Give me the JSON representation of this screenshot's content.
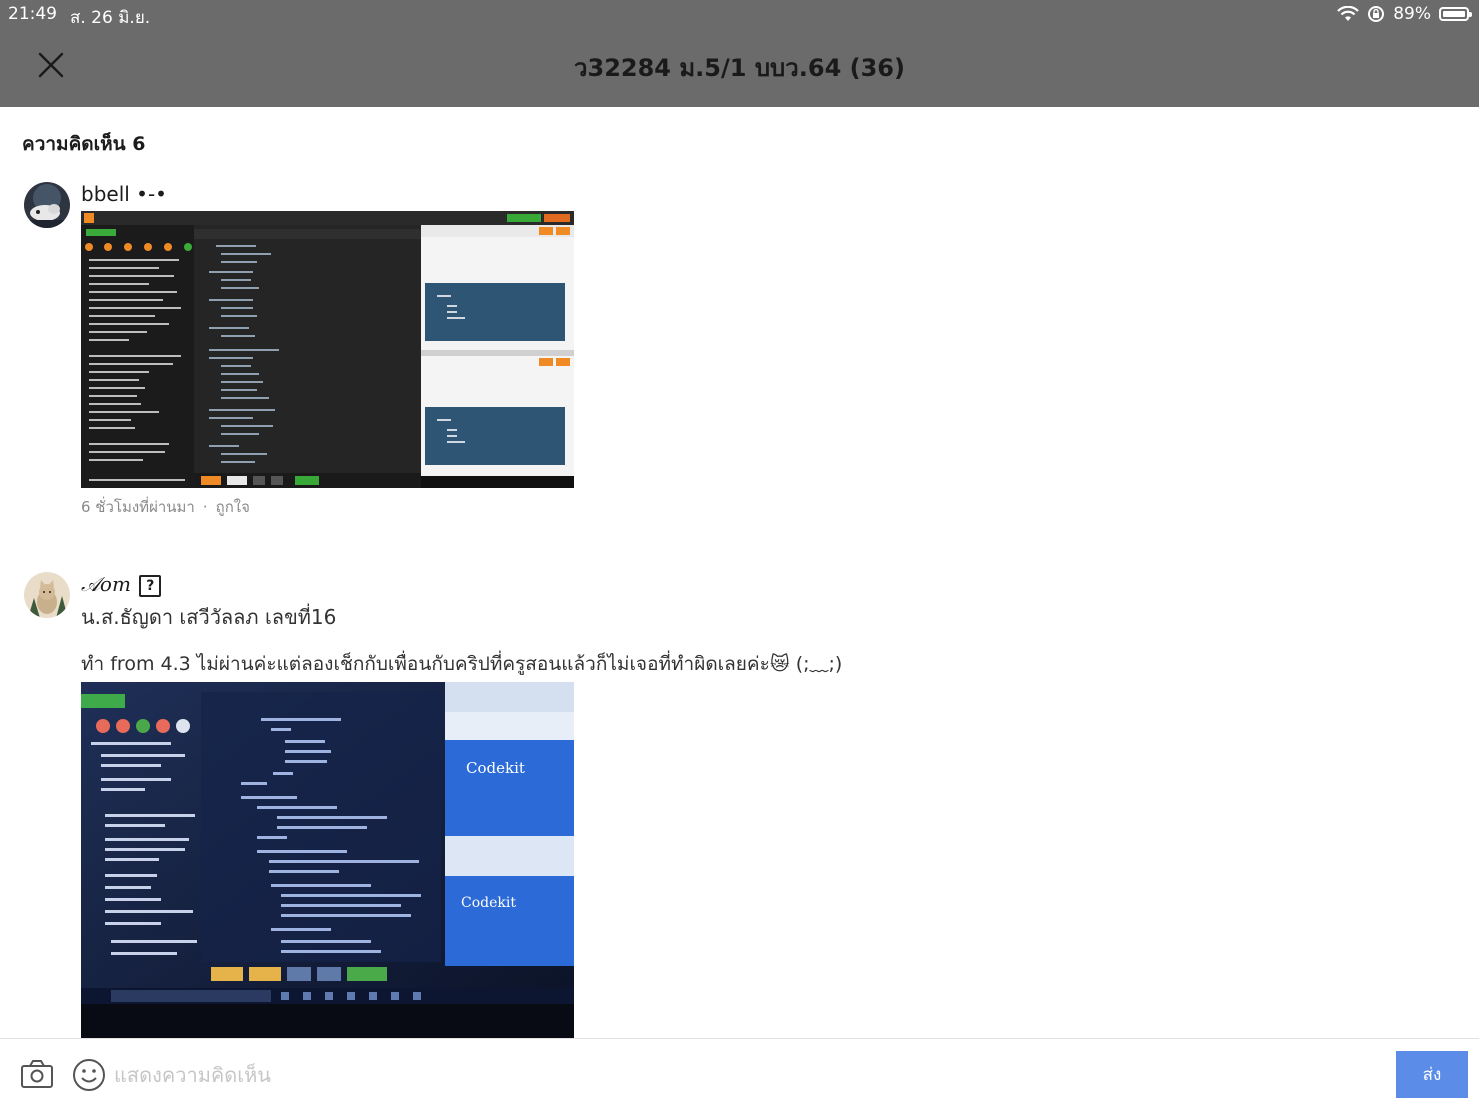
{
  "status_bar": {
    "time": "21:49",
    "date": "ส. 26 มิ.ย.",
    "battery": "89%",
    "battery_level": 0.89
  },
  "header": {
    "title": "ว32284 ม.5/1 บบว.64 (36)"
  },
  "comments_header": "ความคิดเห็น 6",
  "comments": [
    {
      "author": "bbell •-•",
      "time": "6 ชั่วโมงที่ผ่านมา",
      "like_label": "ถูกใจ",
      "image": {
        "alt": "screenshot-of-code-editor"
      }
    },
    {
      "author": "𝒜𝑜𝑚",
      "author_badge": "?",
      "line1": "น.ส.ธัญดา เสวีวัลลภ เลขที่16",
      "line2": "ทำ from 4.3 ไม่ผ่านค่ะแต่ลองเช็กกับเพื่อนกับคริปที่ครูสอนแล้วก็ไม่เจอที่ทำผิดเลยค่ะ😿 (;﹏;)",
      "image": {
        "text_top": "Codekit",
        "text_bottom": "Codekit"
      }
    }
  ],
  "composer": {
    "placeholder": "แสดงความคิดเห็น",
    "send_label": "ส่ง"
  },
  "colors": {
    "header_bg": "#6b6b6b",
    "send_bg": "#5b8de8",
    "accent": "#3b6ea6"
  }
}
